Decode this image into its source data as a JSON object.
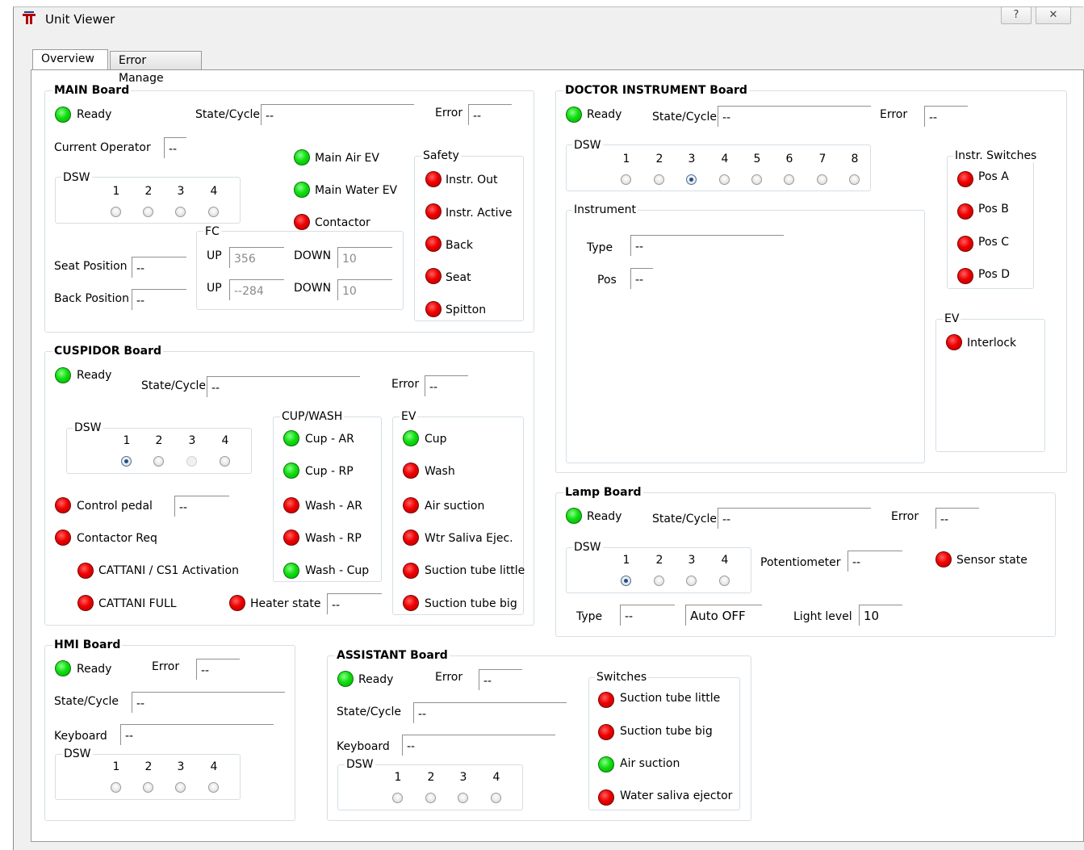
{
  "window": {
    "title": "Unit Viewer",
    "help_btn": "?",
    "close_btn": "✕"
  },
  "tabs": [
    "Overview",
    "Error Manage"
  ],
  "common": {
    "ready": "Ready",
    "state_cycle": "State/Cycle",
    "error": "Error",
    "dsw": "DSW",
    "empty": "--",
    "keyboard": "Keyboard",
    "type": "Type"
  },
  "dsw_numbers": [
    "1",
    "2",
    "3",
    "4",
    "5",
    "6",
    "7",
    "8"
  ],
  "main": {
    "title": "MAIN Board",
    "state_value": "--",
    "error_value": "--",
    "current_operator_label": "Current Operator",
    "current_operator_value": "--",
    "main_air_ev": "Main Air EV",
    "main_water_ev": "Main Water EV",
    "contactor": "Contactor",
    "fc_title": "FC",
    "up": "UP",
    "down": "DOWN",
    "fc_up1": "356",
    "fc_down1": "10",
    "fc_up2": "--284",
    "fc_down2": "10",
    "seat_position_label": "Seat Position",
    "seat_position_value": "--",
    "back_position_label": "Back Position",
    "back_position_value": "--",
    "safety_title": "Safety",
    "safety": [
      "Instr. Out",
      "Instr. Active",
      "Back",
      "Seat",
      "Spitton"
    ]
  },
  "cuspidor": {
    "title": "CUSPIDOR Board",
    "state_value": "--",
    "error_value": "--",
    "control_pedal": "Control pedal",
    "control_pedal_value": "--",
    "contactor_req": "Contactor Req",
    "cattani_activation": "CATTANI / CS1  Activation",
    "cattani_full": "CATTANI FULL",
    "heater_state": "Heater state",
    "heater_value": "--",
    "cupwash_title": "CUP/WASH",
    "cupwash": [
      "Cup - AR",
      "Cup - RP",
      "Wash - AR",
      "Wash - RP",
      "Wash - Cup"
    ],
    "ev_title": "EV",
    "ev": [
      "Cup",
      "Wash",
      "Air suction",
      "Wtr Saliva Ejec.",
      "Suction tube little",
      "Suction tube big"
    ]
  },
  "hmi": {
    "title": "HMI Board",
    "error_value": "--",
    "state_value": "--",
    "keyboard_value": "--"
  },
  "assistant": {
    "title": "ASSISTANT Board",
    "error_value": "--",
    "state_value": "--",
    "keyboard_value": "--",
    "switches_title": "Switches",
    "switches": [
      "Suction tube little",
      "Suction tube big",
      "Air suction",
      "Water saliva ejector"
    ]
  },
  "doctor": {
    "title": "DOCTOR INSTRUMENT Board",
    "state_value": "--",
    "error_value": "--",
    "instrument_title": "Instrument",
    "type_value": "--",
    "pos_label": "Pos",
    "pos_value": "--",
    "switches_title": "Instr. Switches",
    "switches": [
      "Pos A",
      "Pos B",
      "Pos C",
      "Pos D"
    ],
    "ev_title": "EV",
    "interlock": "Interlock"
  },
  "lamp": {
    "title": "Lamp Board",
    "state_value": "--",
    "error_value": "--",
    "potentiometer_label": "Potentiometer",
    "potentiometer_value": "--",
    "sensor_state": "Sensor state",
    "type_value": "--",
    "auto_off": "Auto OFF",
    "light_level_label": "Light level",
    "light_level_value": "10"
  },
  "colors": {
    "led_green": "#11dd11",
    "led_red": "#ee0000",
    "groupbox_border": "#d5dfe5"
  }
}
